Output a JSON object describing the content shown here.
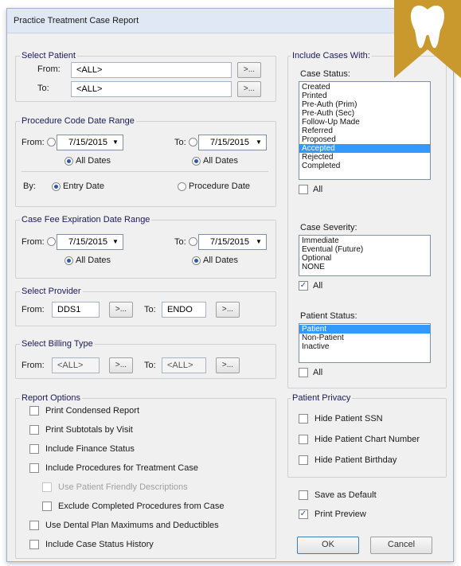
{
  "window": {
    "title": "Practice Treatment Case Report"
  },
  "select_patient": {
    "title": "Select Patient",
    "from_label": "From:",
    "from_value": "<ALL>",
    "to_label": "To:",
    "to_value": "<ALL>",
    "browse_label": ">..."
  },
  "proc_date": {
    "title": "Procedure Code Date Range",
    "from_label": "From:",
    "from_date": "7/15/2015",
    "to_label": "To:",
    "to_date": "7/15/2015",
    "all_dates": "All Dates",
    "by_label": "By:",
    "entry_date": "Entry Date",
    "procedure_date": "Procedure Date"
  },
  "fee_exp": {
    "title": "Case Fee Expiration Date Range",
    "from_label": "From:",
    "from_date": "7/15/2015",
    "to_label": "To:",
    "to_date": "7/15/2015",
    "all_dates": "All Dates"
  },
  "provider": {
    "title": "Select Provider",
    "from_label": "From:",
    "from_value": "DDS1",
    "to_label": "To:",
    "to_value": "ENDO",
    "browse_label": ">..."
  },
  "billing": {
    "title": "Select Billing Type",
    "from_label": "From:",
    "from_value": "<ALL>",
    "to_label": "To:",
    "to_value": "<ALL>",
    "browse_label": ">..."
  },
  "report_options": {
    "title": "Report Options",
    "items": [
      {
        "label": "Print Condensed Report",
        "checked": false
      },
      {
        "label": "Print Subtotals by Visit",
        "checked": false
      },
      {
        "label": "Include Finance Status",
        "checked": false
      },
      {
        "label": "Include Procedures for Treatment Case",
        "checked": false
      },
      {
        "label": "Use Patient Friendly Descriptions",
        "checked": false,
        "disabled": true
      },
      {
        "label": "Exclude Completed Procedures from Case",
        "checked": false
      },
      {
        "label": "Use Dental Plan Maximums and Deductibles",
        "checked": false
      },
      {
        "label": "Include Case Status History",
        "checked": false
      }
    ]
  },
  "include_cases": {
    "title": "Include Cases With:",
    "case_status": {
      "label": "Case Status:",
      "items": [
        "Created",
        "Printed",
        "Pre-Auth (Prim)",
        "Pre-Auth (Sec)",
        "Follow-Up Made",
        "Referred",
        "Proposed",
        "Accepted",
        "Rejected",
        "Completed"
      ],
      "selected": "Accepted",
      "all_label": "All"
    },
    "case_severity": {
      "label": "Case Severity:",
      "items": [
        "Immediate",
        "Eventual (Future)",
        "Optional",
        "NONE"
      ],
      "all_label": "All"
    },
    "patient_status": {
      "label": "Patient Status:",
      "items": [
        "Patient",
        "Non-Patient",
        "Inactive"
      ],
      "selected": "Patient",
      "all_label": "All"
    }
  },
  "privacy": {
    "title": "Patient Privacy",
    "items": [
      "Hide Patient SSN",
      "Hide Patient Chart Number",
      "Hide Patient Birthday"
    ]
  },
  "save_default": "Save as Default",
  "print_preview": "Print Preview",
  "ok": "OK",
  "cancel": "Cancel",
  "accent_color": "#c9992e",
  "selection_color": "#3399ff"
}
